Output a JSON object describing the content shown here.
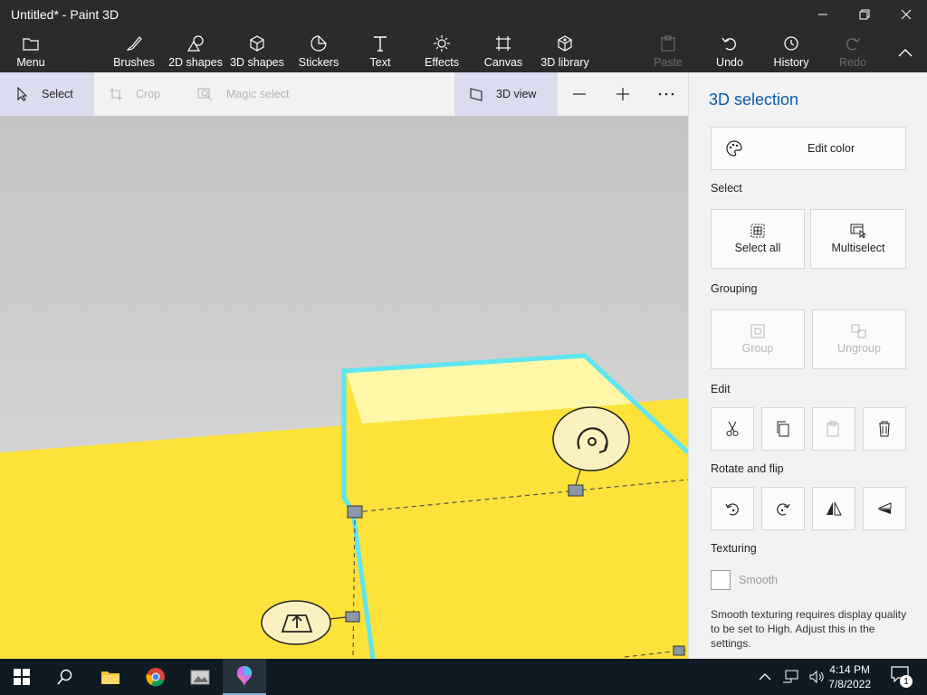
{
  "window": {
    "title": "Untitled* - Paint 3D"
  },
  "ribbon": {
    "menu": "Menu",
    "brushes": "Brushes",
    "shapes2d": "2D shapes",
    "shapes3d": "3D shapes",
    "stickers": "Stickers",
    "text": "Text",
    "effects": "Effects",
    "canvas": "Canvas",
    "library3d": "3D library",
    "paste": "Paste",
    "undo": "Undo",
    "history": "History",
    "redo": "Redo"
  },
  "toolbar": {
    "select": "Select",
    "crop": "Crop",
    "magic_select": "Magic select",
    "view3d": "3D view"
  },
  "panel": {
    "title": "3D selection",
    "edit_color": "Edit color",
    "select_label": "Select",
    "select_all": "Select all",
    "multiselect": "Multiselect",
    "grouping_label": "Grouping",
    "group": "Group",
    "ungroup": "Ungroup",
    "edit_label": "Edit",
    "rotate_label": "Rotate and flip",
    "texturing_label": "Texturing",
    "smooth": "Smooth",
    "smooth_note": "Smooth texturing requires display quality to be set to High. Adjust this in the settings."
  },
  "taskbar": {
    "time": "4:14 PM",
    "date": "7/8/2022",
    "notification_count": "1"
  },
  "colors": {
    "object_yellow": "#fde23a",
    "selection_cyan": "#5ee6f2",
    "accent_blue": "#0b5cad"
  }
}
